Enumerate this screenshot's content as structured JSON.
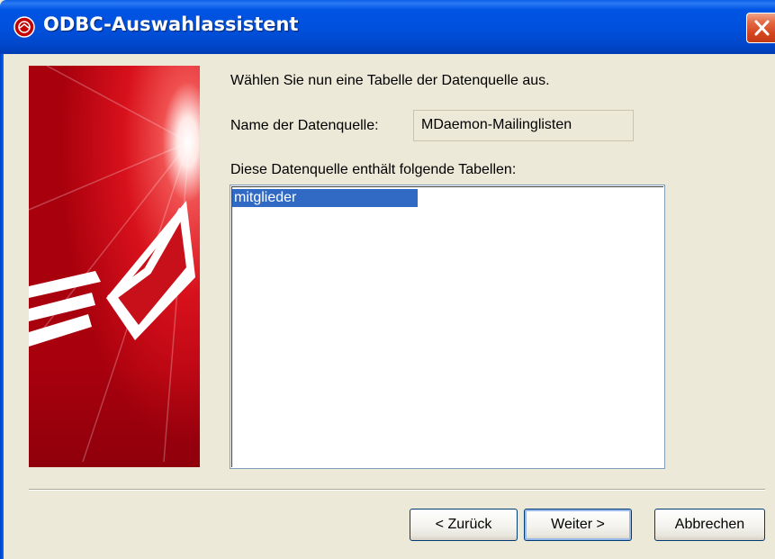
{
  "window": {
    "title": "ODBC-Auswahlassistent"
  },
  "content": {
    "instruction": "Wählen Sie nun eine Tabelle der Datenquelle aus.",
    "datasource_label": "Name der Datenquelle:",
    "datasource_value": "MDaemon-Mailinglisten",
    "tables_label": "Diese Datenquelle enthält folgende Tabellen:",
    "tables": [
      "mitglieder"
    ],
    "selected_table": "mitglieder"
  },
  "buttons": {
    "back": "< Zurück",
    "next": "Weiter >",
    "cancel": "Abbrechen"
  },
  "icons": {
    "app": "mdaemon-app-icon",
    "close": "close-icon",
    "banner": "envelope-banner"
  },
  "colors": {
    "titlebar": "#0054e3",
    "close_button": "#d2441e",
    "selection": "#316ac5",
    "banner_red": "#d0111b"
  }
}
